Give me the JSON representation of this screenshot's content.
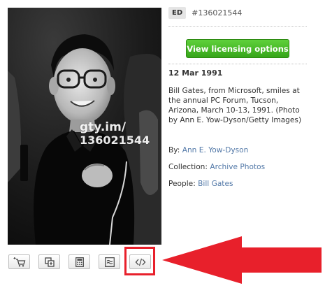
{
  "photo": {
    "watermark_brand": "gty.im/",
    "watermark_id": "136021544"
  },
  "info": {
    "badge": "ED",
    "asset_id": "#136021544",
    "license_button": "View licensing options",
    "date": "12 Mar 1991",
    "caption": "Bill Gates, from Microsoft, smiles at the annual PC Forum, Tucson, Arizona, March 10-13, 1991. (Photo by Ann E. Yow-Dyson/Getty Images)",
    "by_label": "By:",
    "by_value": "Ann E. Yow-Dyson",
    "collection_label": "Collection:",
    "collection_value": "Archive Photos",
    "people_label": "People:",
    "people_value": "Bill Gates"
  },
  "toolbar": {
    "buttons": [
      {
        "icon": "add-to-cart-icon"
      },
      {
        "icon": "add-to-board-icon"
      },
      {
        "icon": "calculator-icon"
      },
      {
        "icon": "similar-images-icon"
      },
      {
        "icon": "embed-code-icon"
      }
    ]
  },
  "colors": {
    "accent_green": "#43b727",
    "link_blue": "#5379a8",
    "highlight_red": "#e8202b"
  }
}
